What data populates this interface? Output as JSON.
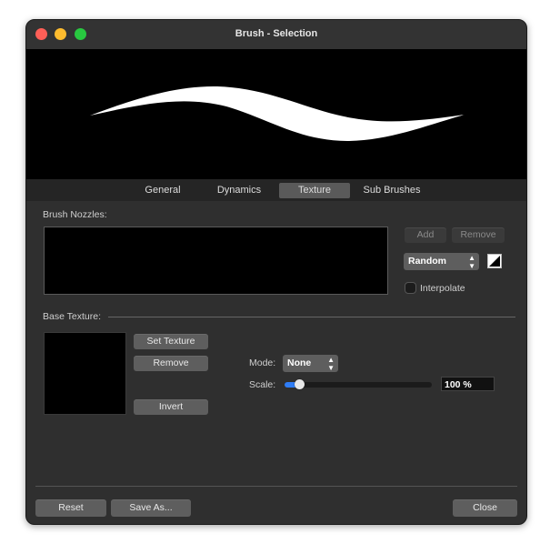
{
  "window": {
    "title": "Brush - Selection"
  },
  "tabs": [
    {
      "label": "General",
      "active": false
    },
    {
      "label": "Dynamics",
      "active": false
    },
    {
      "label": "Texture",
      "active": true
    },
    {
      "label": "Sub Brushes",
      "active": false
    }
  ],
  "nozzles": {
    "label": "Brush Nozzles:",
    "add_label": "Add",
    "remove_label": "Remove",
    "order_value": "Random",
    "interpolate_label": "Interpolate",
    "interpolate_checked": false
  },
  "base_texture": {
    "label": "Base Texture:",
    "set_texture_label": "Set Texture",
    "remove_label": "Remove",
    "invert_label": "Invert",
    "mode_label": "Mode:",
    "mode_value": "None",
    "scale_label": "Scale:",
    "scale_value": "100 %",
    "scale_slider_fraction": 0.1
  },
  "footer": {
    "reset_label": "Reset",
    "save_as_label": "Save As...",
    "close_label": "Close"
  },
  "colors": {
    "window_bg": "#2f2f2f",
    "accent": "#2f7df6",
    "close": "#ff5f57",
    "minimize": "#febc2e",
    "maximize": "#28c840"
  }
}
